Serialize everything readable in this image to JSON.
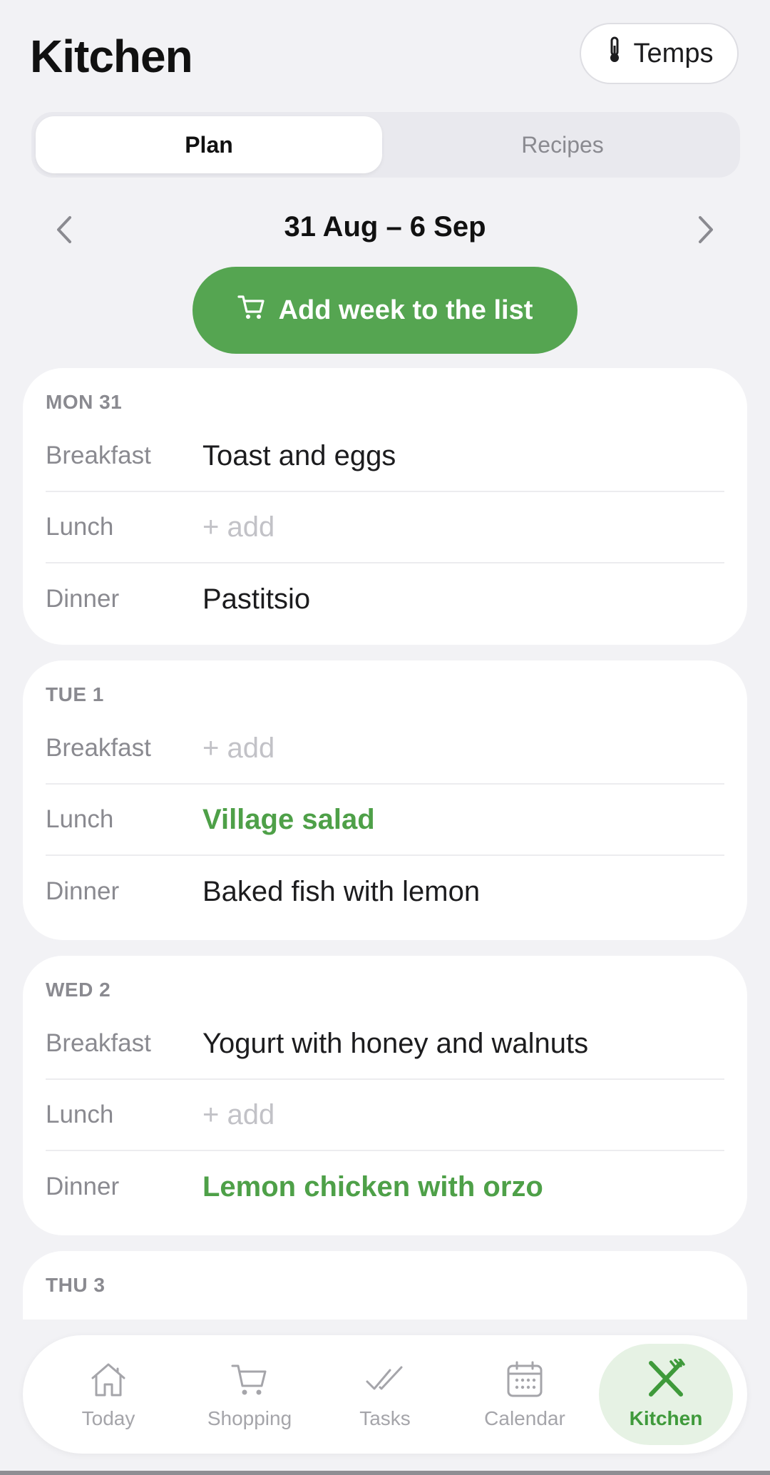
{
  "header": {
    "title": "Kitchen",
    "temps_label": "Temps"
  },
  "tabs": [
    {
      "label": "Plan",
      "active": true
    },
    {
      "label": "Recipes",
      "active": false
    }
  ],
  "week": {
    "range": "31 Aug – 6 Sep"
  },
  "add_week_label": "Add week to the list",
  "days": [
    {
      "label": "MON 31",
      "meals": [
        {
          "type": "Breakfast",
          "value": "Toast and eggs",
          "kind": "text"
        },
        {
          "type": "Lunch",
          "value": "+ add",
          "kind": "placeholder"
        },
        {
          "type": "Dinner",
          "value": "Pastitsio",
          "kind": "text"
        }
      ]
    },
    {
      "label": "TUE 1",
      "meals": [
        {
          "type": "Breakfast",
          "value": "+ add",
          "kind": "placeholder"
        },
        {
          "type": "Lunch",
          "value": "Village salad",
          "kind": "recipe"
        },
        {
          "type": "Dinner",
          "value": "Baked fish with lemon",
          "kind": "text"
        }
      ]
    },
    {
      "label": "WED 2",
      "meals": [
        {
          "type": "Breakfast",
          "value": "Yogurt with honey and walnuts",
          "kind": "text"
        },
        {
          "type": "Lunch",
          "value": "+ add",
          "kind": "placeholder"
        },
        {
          "type": "Dinner",
          "value": "Lemon chicken with orzo",
          "kind": "recipe"
        }
      ]
    },
    {
      "label": "THU 3",
      "meals": []
    }
  ],
  "nav": [
    {
      "label": "Today",
      "icon": "house-icon",
      "active": false
    },
    {
      "label": "Shopping",
      "icon": "cart-icon",
      "active": false
    },
    {
      "label": "Tasks",
      "icon": "double-check-icon",
      "active": false
    },
    {
      "label": "Calendar",
      "icon": "calendar-icon",
      "active": false
    },
    {
      "label": "Kitchen",
      "icon": "fork-knife-icon",
      "active": true
    }
  ],
  "colors": {
    "accent": "#55a551",
    "recipe_text": "#4ea048",
    "active_nav_bg": "#e6f2e4",
    "background": "#f2f2f5"
  }
}
